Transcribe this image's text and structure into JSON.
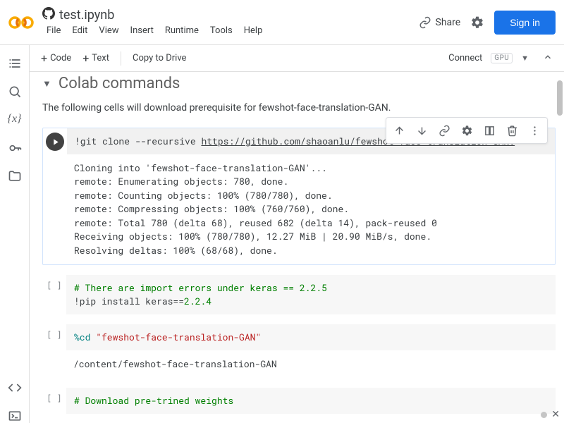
{
  "header": {
    "title": "test.ipynb",
    "menu": [
      "File",
      "Edit",
      "View",
      "Insert",
      "Runtime",
      "Tools",
      "Help"
    ],
    "share": "Share",
    "signin": "Sign in"
  },
  "secondary": {
    "code": "Code",
    "text": "Text",
    "copy": "Copy to Drive",
    "connect": "Connect",
    "gpu": "GPU"
  },
  "section": {
    "title": "Colab commands",
    "intro": "The following cells will download prerequisite for fewshot-face-translation-GAN."
  },
  "cells": [
    {
      "active": true,
      "code_prefix": "!git clone --recursive ",
      "code_url": "https://github.com/shaoanlu/fewshot-face-translation-GAN.",
      "output": "Cloning into 'fewshot-face-translation-GAN'...\nremote: Enumerating objects: 780, done.\nremote: Counting objects: 100% (780/780), done.\nremote: Compressing objects: 100% (760/760), done.\nremote: Total 780 (delta 68), reused 682 (delta 14), pack-reused 0\nReceiving objects: 100% (780/780), 12.27 MiB | 20.90 MiB/s, done.\nResolving deltas: 100% (68/68), done."
    },
    {
      "comment": "# There are import errors under keras == 2.2.5",
      "line2_pre": "!pip install keras==",
      "line2_num": "2.2.4"
    },
    {
      "magic": "%cd",
      "arg": " \"fewshot-face-translation-GAN\"",
      "output": "/content/fewshot-face-translation-GAN"
    },
    {
      "comment": "# Download pre-trined weights"
    }
  ]
}
